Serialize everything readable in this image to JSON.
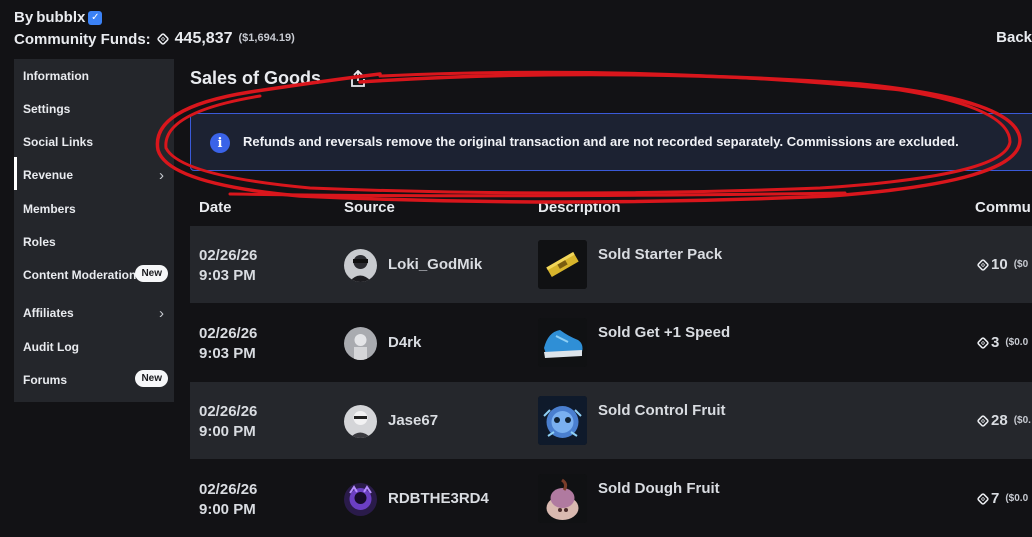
{
  "header": {
    "by_prefix": "By",
    "owner": "bubblx",
    "funds_label": "Community Funds:",
    "funds_amount": "445,837",
    "funds_usd": "($1,694.19)",
    "back_label": "Back"
  },
  "sidebar": {
    "items": [
      {
        "label": "Information"
      },
      {
        "label": "Settings"
      },
      {
        "label": "Social Links"
      },
      {
        "label": "Revenue"
      },
      {
        "label": "Members"
      },
      {
        "label": "Roles"
      },
      {
        "label": "Content Moderation",
        "badge": "New"
      },
      {
        "label": "Affiliates"
      },
      {
        "label": "Audit Log"
      },
      {
        "label": "Forums",
        "badge": "New"
      }
    ]
  },
  "main": {
    "title": "Sales of Goods",
    "notice": "Refunds and reversals remove the original transaction and are not recorded separately. Commissions are excluded.",
    "columns": {
      "date": "Date",
      "source": "Source",
      "description": "Description",
      "commission": "Commu"
    },
    "rows": [
      {
        "date": "02/26/26",
        "time": "9:03 PM",
        "source": "Loki_GodMik",
        "description": "Sold Starter Pack",
        "amount": "10",
        "usd": "($0"
      },
      {
        "date": "02/26/26",
        "time": "9:03 PM",
        "source": "D4rk",
        "description": "Sold Get +1 Speed",
        "amount": "3",
        "usd": "($0.0"
      },
      {
        "date": "02/26/26",
        "time": "9:00 PM",
        "source": "Jase67",
        "description": "Sold Control Fruit",
        "amount": "28",
        "usd": "($0."
      },
      {
        "date": "02/26/26",
        "time": "9:00 PM",
        "source": "RDBTHE3RD4",
        "description": "Sold Dough Fruit",
        "amount": "7",
        "usd": "($0.0"
      }
    ]
  },
  "colors": {
    "accent": "#3a63e8",
    "annotation": "#d9161c",
    "background": "#121215",
    "sidebar": "#24262b"
  }
}
